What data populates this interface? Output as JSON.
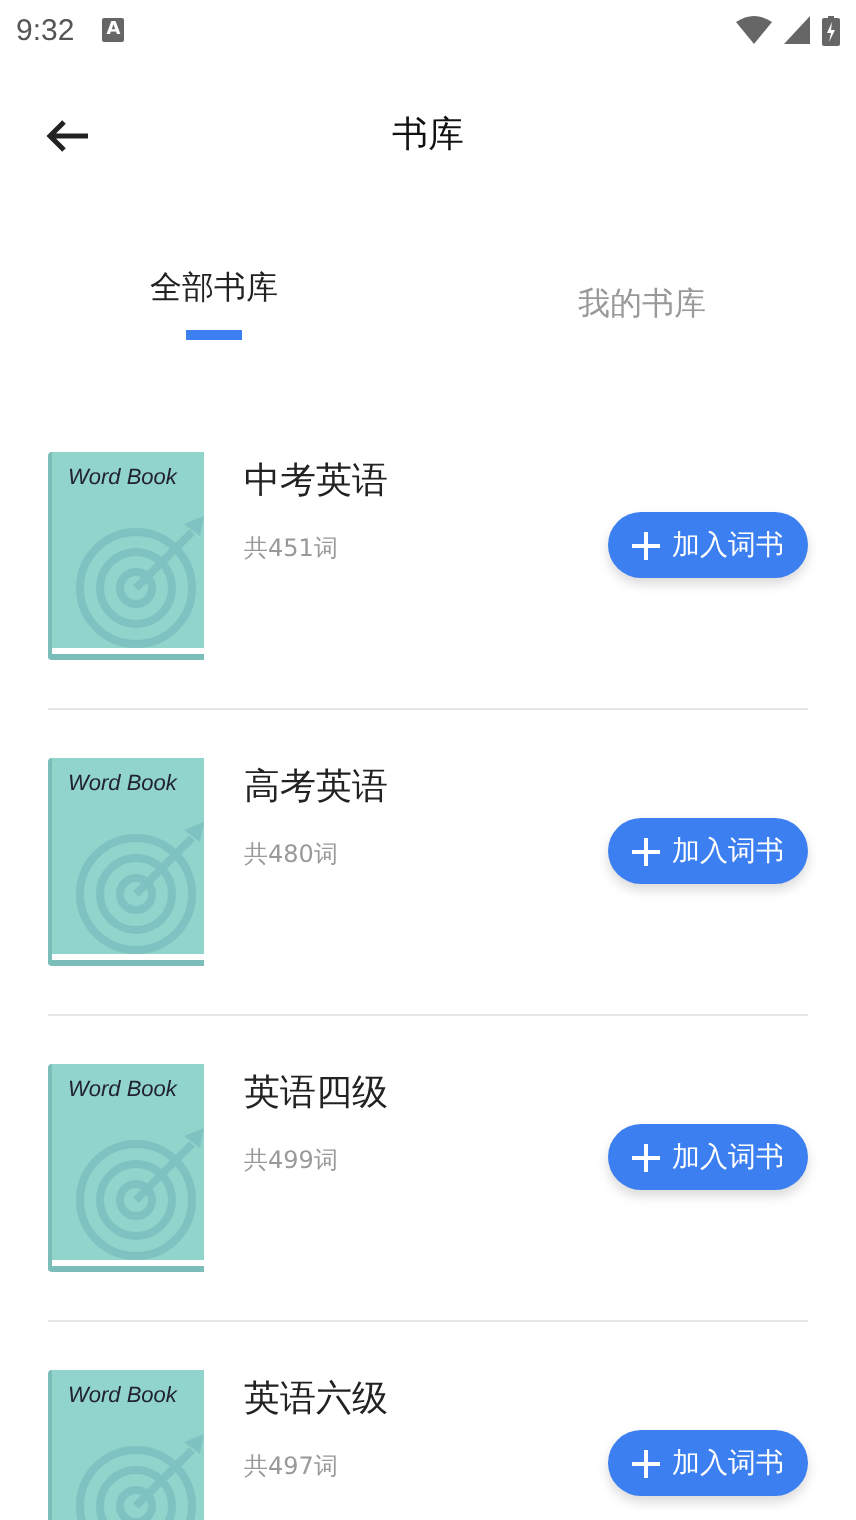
{
  "status_bar": {
    "time": "9:32",
    "notification": "A"
  },
  "header": {
    "title": "书库"
  },
  "tabs": [
    {
      "label": "全部书库",
      "selected": true
    },
    {
      "label": "我的书库",
      "selected": false
    }
  ],
  "books": [
    {
      "cover_text": "Word Book",
      "title": "中考英语",
      "count": "共451词",
      "button": "加入词书"
    },
    {
      "cover_text": "Word Book",
      "title": "高考英语",
      "count": "共480词",
      "button": "加入词书"
    },
    {
      "cover_text": "Word Book",
      "title": "英语四级",
      "count": "共499词",
      "button": "加入词书"
    },
    {
      "cover_text": "Word Book",
      "title": "英语六级",
      "count": "共497词",
      "button": "加入词书"
    }
  ]
}
